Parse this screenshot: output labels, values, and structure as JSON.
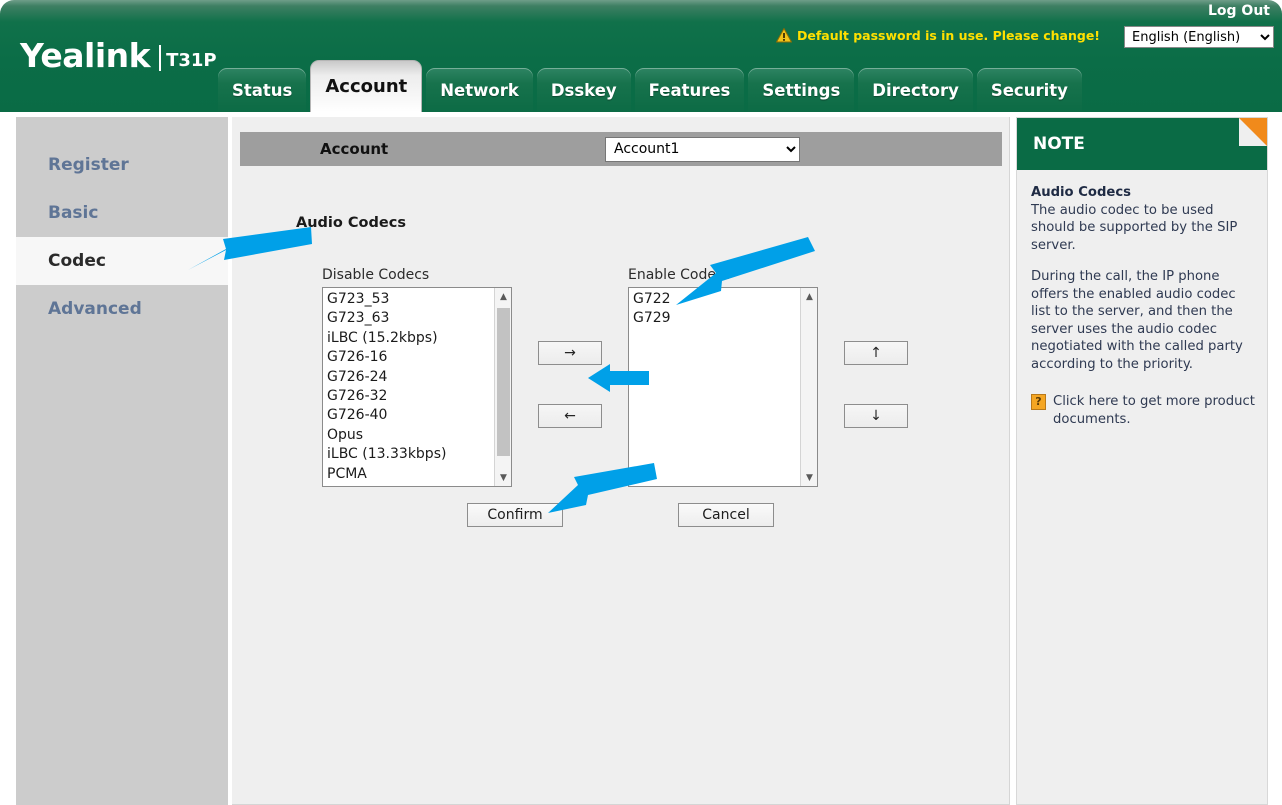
{
  "header": {
    "logo_name": "Yealink",
    "logo_model": "T31P",
    "logout_label": "Log Out",
    "warning_text": "Default password is in use. Please change!",
    "warning_icon": "warning-triangle-icon",
    "language_selected": "English (English)",
    "language_options": [
      "English (English)"
    ],
    "accent_green": "#0a6b45",
    "warning_yellow": "#ffe000"
  },
  "tabs": [
    {
      "label": "Status",
      "active": false
    },
    {
      "label": "Account",
      "active": true
    },
    {
      "label": "Network",
      "active": false
    },
    {
      "label": "Dsskey",
      "active": false
    },
    {
      "label": "Features",
      "active": false
    },
    {
      "label": "Settings",
      "active": false
    },
    {
      "label": "Directory",
      "active": false
    },
    {
      "label": "Security",
      "active": false
    }
  ],
  "sidebar": {
    "items": [
      {
        "label": "Register",
        "active": false
      },
      {
        "label": "Basic",
        "active": false
      },
      {
        "label": "Codec",
        "active": true
      },
      {
        "label": "Advanced",
        "active": false
      }
    ]
  },
  "main": {
    "account_bar": {
      "label": "Account",
      "selected": "Account1",
      "options": [
        "Account1"
      ]
    },
    "section_title": "Audio Codecs",
    "disable_list": {
      "label": "Disable Codecs",
      "items": [
        "G723_53",
        "G723_63",
        "iLBC (15.2kbps)",
        "G726-16",
        "G726-24",
        "G726-32",
        "G726-40",
        "Opus",
        "iLBC (13.33kbps)",
        "PCMA"
      ]
    },
    "enable_list": {
      "label": "Enable Codecs",
      "items": [
        "G722",
        "G729"
      ]
    },
    "transfer_buttons": {
      "to_enable": "→",
      "to_disable": "←",
      "move_up": "↑",
      "move_down": "↓"
    },
    "action_buttons": {
      "confirm": "Confirm",
      "cancel": "Cancel"
    }
  },
  "note": {
    "title": "NOTE",
    "heading": "Audio Codecs",
    "paragraph1": "The audio codec to be used should be supported by the SIP server.",
    "paragraph2": "During the call, the IP phone offers the enabled audio codec list to the server, and then the server uses the audio codec negotiated with the called party according to the priority.",
    "link_text": "Click here to get more product documents.",
    "link_icon": "help-document-icon"
  },
  "annotations": {
    "arrow_color": "#00a0e8",
    "arrows": [
      {
        "name": "arrow-to-codec-sidebar",
        "points_to": "Codec"
      },
      {
        "name": "arrow-to-enable-codecs",
        "points_to": "Enable Codecs list"
      },
      {
        "name": "arrow-to-transfer-buttons",
        "points_to": "transfer buttons"
      },
      {
        "name": "arrow-to-confirm",
        "points_to": "Confirm"
      }
    ]
  }
}
